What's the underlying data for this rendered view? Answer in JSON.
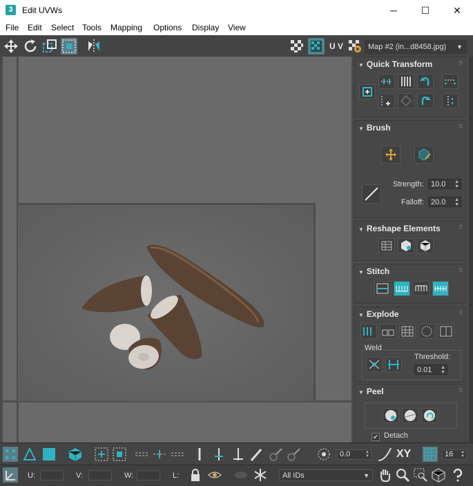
{
  "window": {
    "app_icon": "3",
    "title": "Edit UVWs",
    "minimize": "─",
    "maximize": "☐",
    "close": "✕"
  },
  "menu": [
    "File",
    "Edit",
    "Select",
    "Tools",
    "Mapping",
    "Options",
    "Display",
    "View"
  ],
  "toolbar": {
    "uv_label": "U V",
    "map_select": "Map #2 (in...d8458.jpg)"
  },
  "panel": {
    "quick_transform": {
      "title": "Quick Transform"
    },
    "brush": {
      "title": "Brush",
      "strength_label": "Strength:",
      "strength_value": "10.0",
      "falloff_label": "Falloff:",
      "falloff_value": "20.0"
    },
    "reshape": {
      "title": "Reshape Elements"
    },
    "stitch": {
      "title": "Stitch"
    },
    "explode": {
      "title": "Explode",
      "weld_label": "Weld",
      "threshold_label": "Threshold:",
      "threshold_value": "0.01"
    },
    "peel": {
      "title": "Peel",
      "detach_label": "Detach",
      "detach_checked": true
    }
  },
  "bottom_toolbar": {
    "angle_value": "0.0",
    "xy_label": "XY",
    "grid_value": "16"
  },
  "status_bar": {
    "u_label": "U:",
    "v_label": "V:",
    "w_label": "W:",
    "l_label": "L:",
    "ids_select": "All IDs"
  },
  "colors": {
    "accent": "#29b6c2",
    "panel_bg": "#4a4a4a",
    "viewport_bg": "#6a6a6a",
    "toolbar_bg": "#444444"
  }
}
